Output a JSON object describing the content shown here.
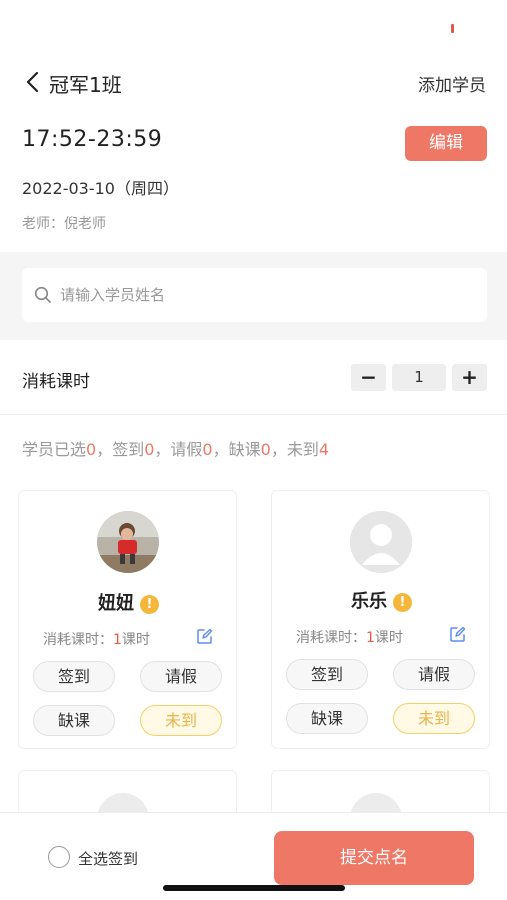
{
  "header": {
    "title": "冠军1班",
    "action_label": "添加学员"
  },
  "session": {
    "time_range": "17:52-23:59",
    "edit_label": "编辑",
    "date": "2022-03-10（周四）",
    "teacher": "老师：倪老师"
  },
  "search": {
    "placeholder": "请输入学员姓名",
    "value": ""
  },
  "consume": {
    "label": "消耗课时",
    "minus": "−",
    "value": "1",
    "plus": "+"
  },
  "summary": {
    "selected_label": "学员已选",
    "selected": "0",
    "signed_label": "，签到",
    "signed": "0",
    "leave_label": "，请假",
    "leave": "0",
    "absent_label": "，缺课",
    "absent": "0",
    "notarrived_label": "，未到",
    "notarrived": "4"
  },
  "students": [
    {
      "name": "妞妞",
      "warn": "!",
      "hours_label": "消耗课时：",
      "hours_value": "1",
      "hours_unit": "课时",
      "actions": {
        "sign": "签到",
        "leave": "请假",
        "absent": "缺课",
        "not_arrived": "未到"
      }
    },
    {
      "name": "乐乐",
      "warn": "!",
      "hours_label": "消耗课时：",
      "hours_value": "1",
      "hours_unit": "课时",
      "actions": {
        "sign": "签到",
        "leave": "请假",
        "absent": "缺课",
        "not_arrived": "未到"
      }
    }
  ],
  "footer": {
    "select_all_label": "全选签到",
    "submit_label": "提交点名"
  },
  "colors": {
    "accent": "#ee7766",
    "warning": "#f5b73b",
    "absent_active": "#e9b44a"
  }
}
